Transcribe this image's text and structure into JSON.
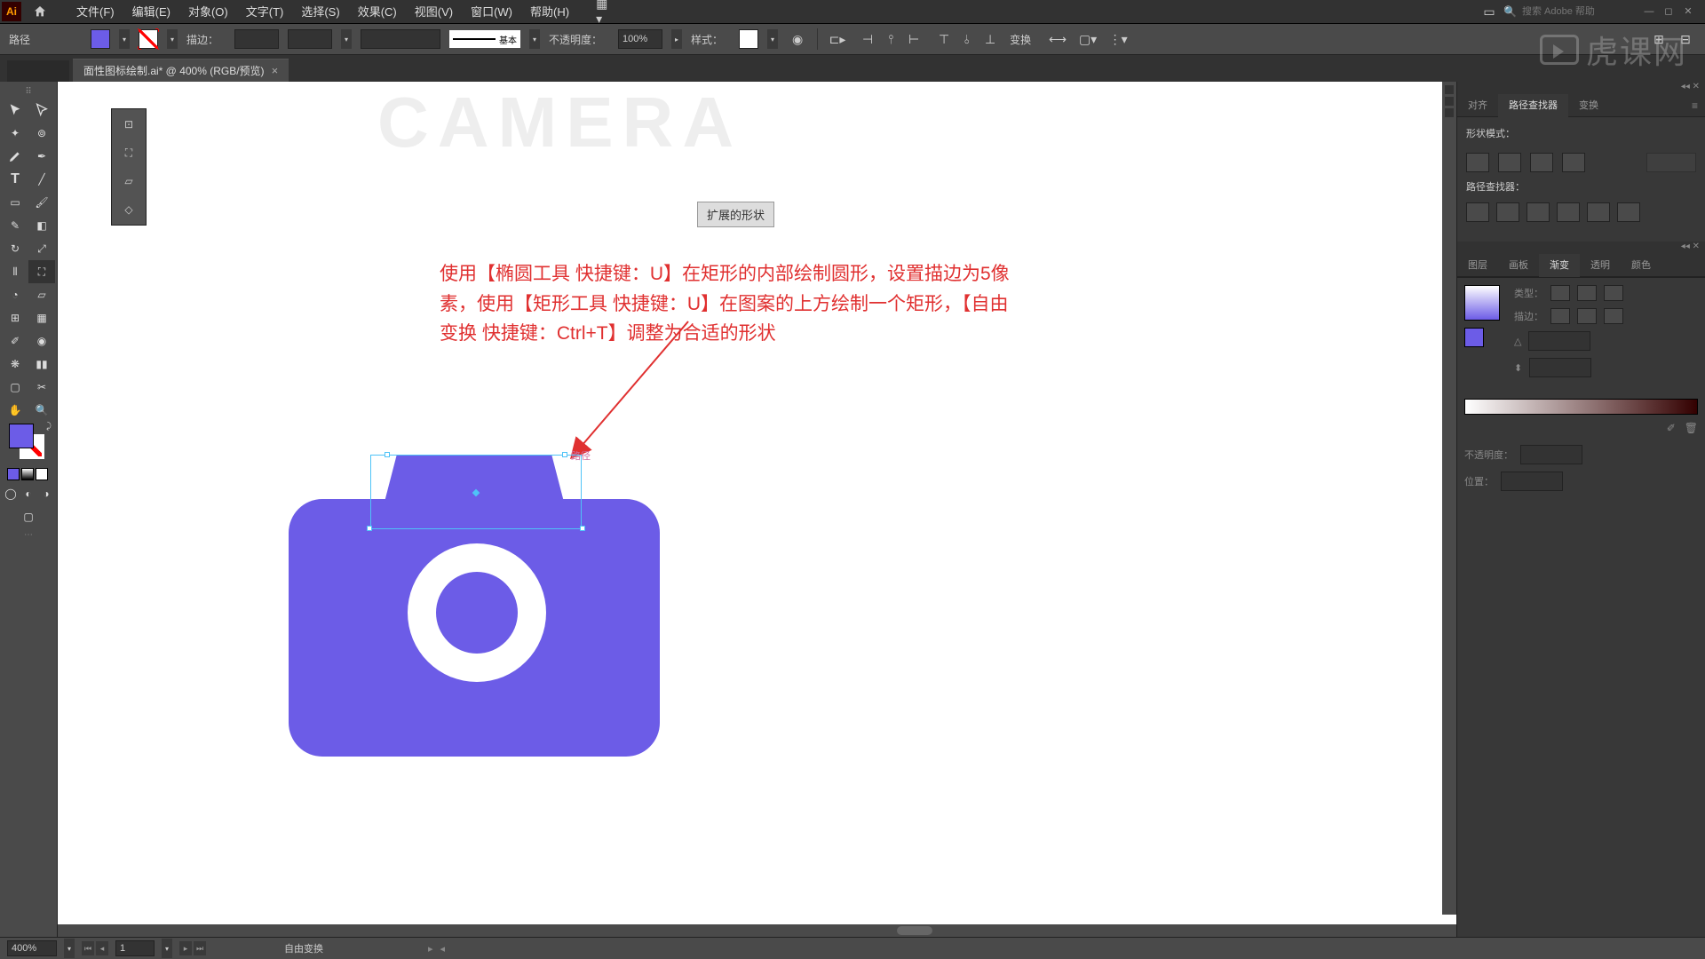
{
  "app": {
    "icon_text": "Ai"
  },
  "menu": {
    "file": "文件(F)",
    "edit": "编辑(E)",
    "object": "对象(O)",
    "type": "文字(T)",
    "select": "选择(S)",
    "effect": "效果(C)",
    "view": "视图(V)",
    "window": "窗口(W)",
    "help": "帮助(H)"
  },
  "header_search": {
    "placeholder": "搜索 Adobe 帮助"
  },
  "controlbar": {
    "sel_label": "路径",
    "stroke_label": "描边：",
    "stroke_profile": "基本",
    "opacity_label": "不透明度：",
    "opacity_value": "100%",
    "style_label": "样式：",
    "transform_label": "变换"
  },
  "doc_tab": {
    "title": "面性图标绘制.ai* @ 400% (RGB/预览)"
  },
  "canvas": {
    "bg_title": "CAMERA",
    "info_button": "扩展的形状",
    "annotation": "使用【椭圆工具 快捷键：U】在矩形的内部绘制圆形，设置描边为5像素，使用【矩形工具 快捷键：U】在图案的上方绘制一个矩形，【自由变换 快捷键：Ctrl+T】调整为合适的形状",
    "path_label": "路径"
  },
  "panels": {
    "align_tab": "对齐",
    "pathfinder_tab": "路径查找器",
    "transform_tab": "变换",
    "shape_mode": "形状模式：",
    "pathfinder_label": "路径查找器：",
    "layers_tab": "图层",
    "artboards_tab": "画板",
    "gradient_tab": "渐变",
    "transparency_tab": "透明",
    "color_tab": "颜色",
    "type_label": "类型：",
    "stroke_label2": "描边：",
    "opacity_label2": "不透明度：",
    "position_label": "位置："
  },
  "statusbar": {
    "zoom": "400%",
    "page": "1",
    "tool": "自由变换"
  },
  "watermark": {
    "text": "虎课网"
  }
}
